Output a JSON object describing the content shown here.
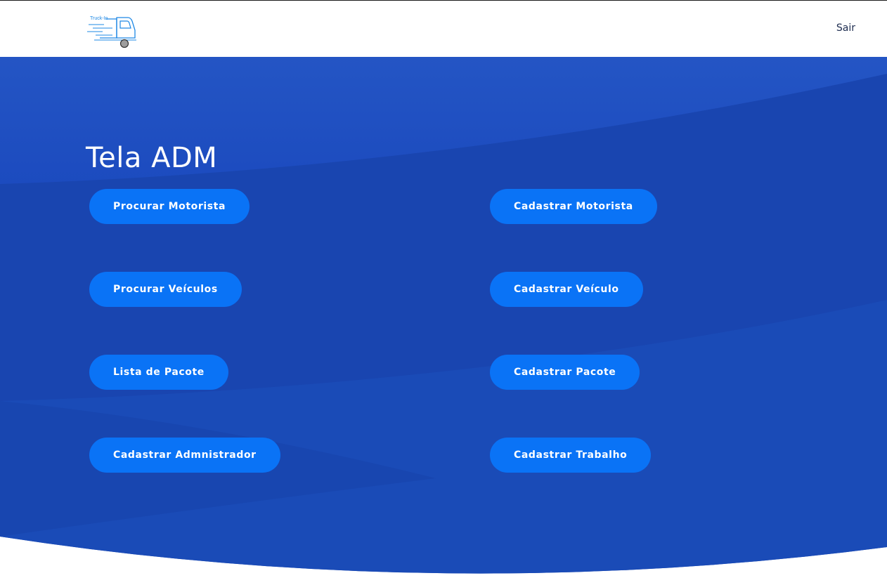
{
  "header": {
    "logo_text": "Truck-In",
    "logout_label": "Sair"
  },
  "main": {
    "title": "Tela ADM",
    "buttons": {
      "procurar_motorista": "Procurar Motorista",
      "cadastrar_motorista": "Cadastrar Motorista",
      "procurar_veiculos": "Procurar Veículos",
      "cadastrar_veiculo": "Cadastrar Veículo",
      "lista_pacote": "Lista de Pacote",
      "cadastrar_pacote": "Cadastrar Pacote",
      "cadastrar_admin": "Cadastrar Admnistrador",
      "cadastrar_trabalho": "Cadastrar Trabalho"
    }
  },
  "colors": {
    "hero_blue": "#1a47b5",
    "button_blue": "#0a73f6",
    "logout_text": "#1b2a4e",
    "logo_blue": "#1e88e5"
  },
  "icons": {
    "logo": "truck-icon"
  }
}
